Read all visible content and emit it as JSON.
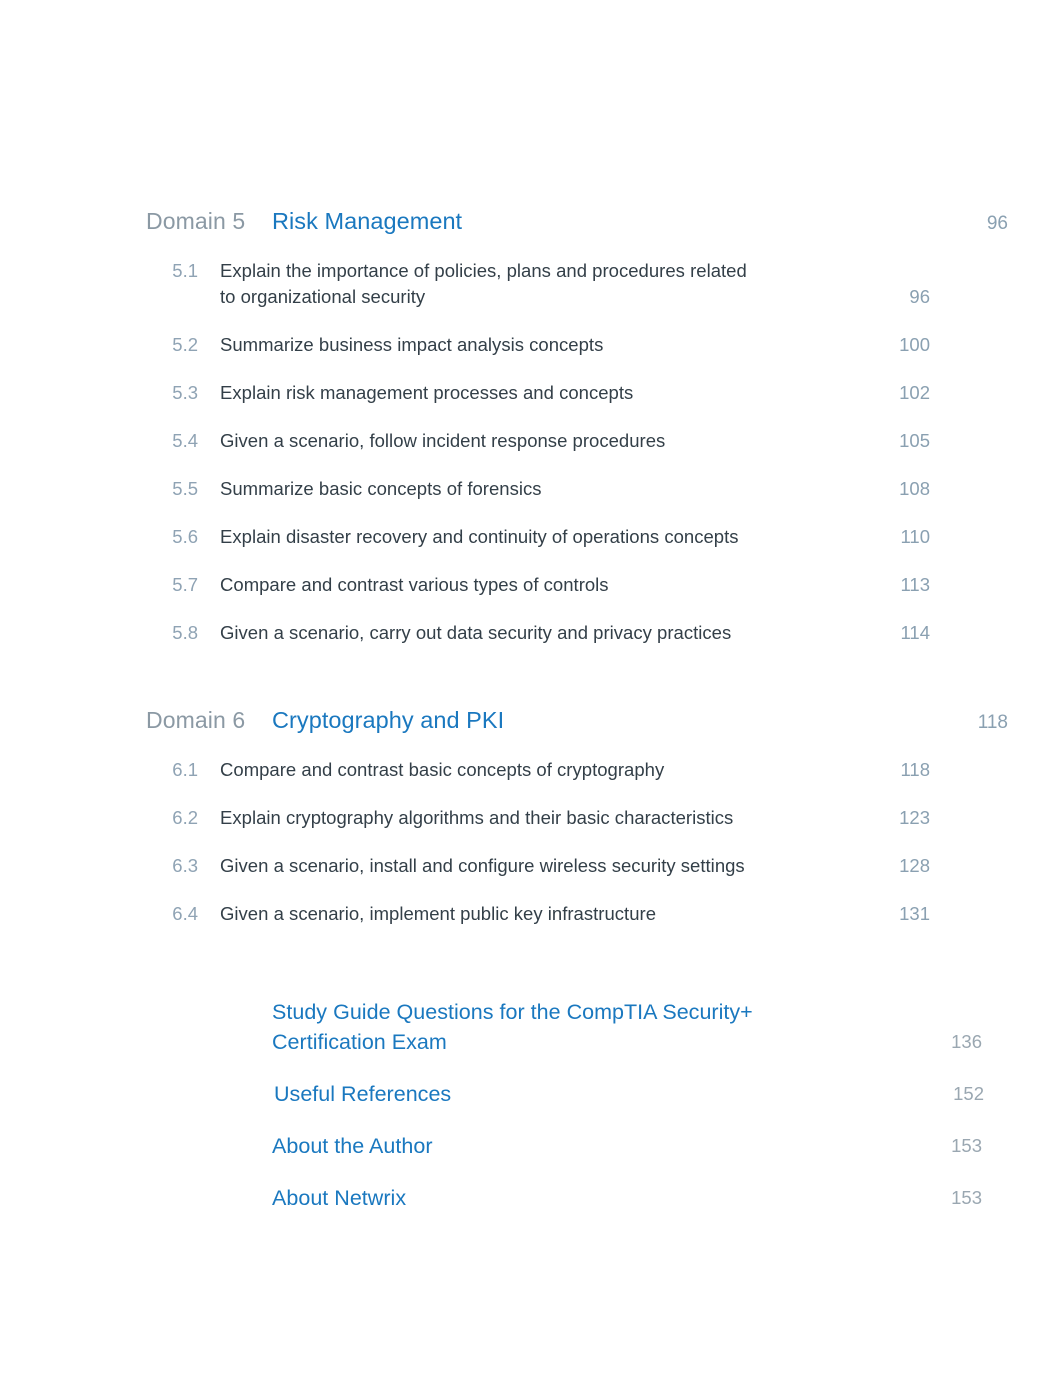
{
  "colors": {
    "heading_blue": "#1a78bf",
    "body_text": "#333f48",
    "muted_number": "#8aa0b1",
    "domain_label": "#8b99a4",
    "page_background": "#ffffff"
  },
  "domains": [
    {
      "label": "Domain 5",
      "title": "Risk Management",
      "page": "96",
      "entries": [
        {
          "num": "5.1",
          "line1": "Explain the importance of policies, plans and procedures related",
          "line2": "to organizational security",
          "page": "96"
        },
        {
          "num": "5.2",
          "line1": "Summarize business impact analysis concepts",
          "line2": "",
          "page": "100"
        },
        {
          "num": "5.3",
          "line1": "Explain risk management processes and concepts",
          "line2": "",
          "page": "102"
        },
        {
          "num": "5.4",
          "line1": "Given a scenario, follow incident response procedures",
          "line2": "",
          "page": "105"
        },
        {
          "num": "5.5",
          "line1": "Summarize basic concepts of forensics",
          "line2": "",
          "page": "108"
        },
        {
          "num": "5.6",
          "line1": "Explain disaster recovery and continuity of operations concepts",
          "line2": "",
          "page": "110"
        },
        {
          "num": "5.7",
          "line1": "Compare and contrast various types of controls",
          "line2": "",
          "page": "113"
        },
        {
          "num": "5.8",
          "line1": "Given a scenario, carry out data security and privacy practices",
          "line2": "",
          "page": "114"
        }
      ]
    },
    {
      "label": "Domain 6",
      "title": "Cryptography and PKI",
      "page": "118",
      "entries": [
        {
          "num": "6.1",
          "line1": "Compare and contrast basic concepts of cryptography",
          "line2": "",
          "page": "118"
        },
        {
          "num": "6.2",
          "line1": "Explain cryptography algorithms and their basic characteristics",
          "line2": "",
          "page": "123"
        },
        {
          "num": "6.3",
          "line1": "Given a scenario, install and configure wireless security settings",
          "line2": "",
          "page": "128"
        },
        {
          "num": "6.4",
          "line1": "Given a scenario, implement public key infrastructure",
          "line2": "",
          "page": "131"
        }
      ]
    }
  ],
  "extras": [
    {
      "line1": "Study Guide Questions for the CompTIA Security+",
      "line2": "Certification Exam",
      "page": "136"
    },
    {
      "line1": "Useful References",
      "line2": "",
      "page": "152"
    },
    {
      "line1": "About the Author",
      "line2": "",
      "page": "153"
    },
    {
      "line1": "About Netwrix",
      "line2": "",
      "page": "153"
    }
  ]
}
